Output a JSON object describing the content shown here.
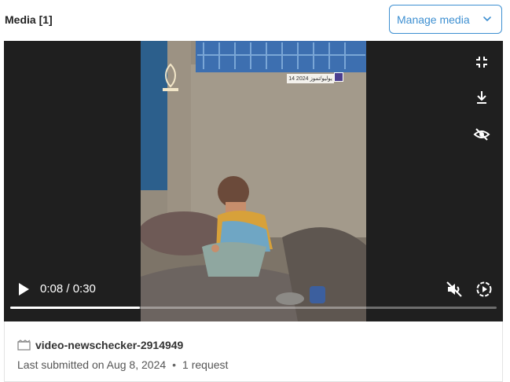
{
  "header": {
    "title": "Media [1]",
    "manage_button_label": "Manage media"
  },
  "player": {
    "current_time": "0:08",
    "duration": "0:30",
    "time_display": "0:08 / 0:30",
    "progress": 0.2667,
    "overlay_date_text": "14 يوليو/تموز 2024",
    "icons": {
      "top_right": [
        "fullscreen-exit-icon",
        "download-icon",
        "eye-off-icon"
      ],
      "bottom_left": [
        "play-icon"
      ],
      "bottom_right": [
        "volume-muted-icon",
        "playback-speed-icon"
      ]
    }
  },
  "file": {
    "name": "video-newschecker-2914949",
    "meta_submitted": "Last submitted on Aug 8, 2024",
    "meta_separator": "•",
    "meta_requests": "1 request"
  },
  "colors": {
    "accent": "#3d8fd1",
    "player_bg": "#1f1f1f"
  }
}
